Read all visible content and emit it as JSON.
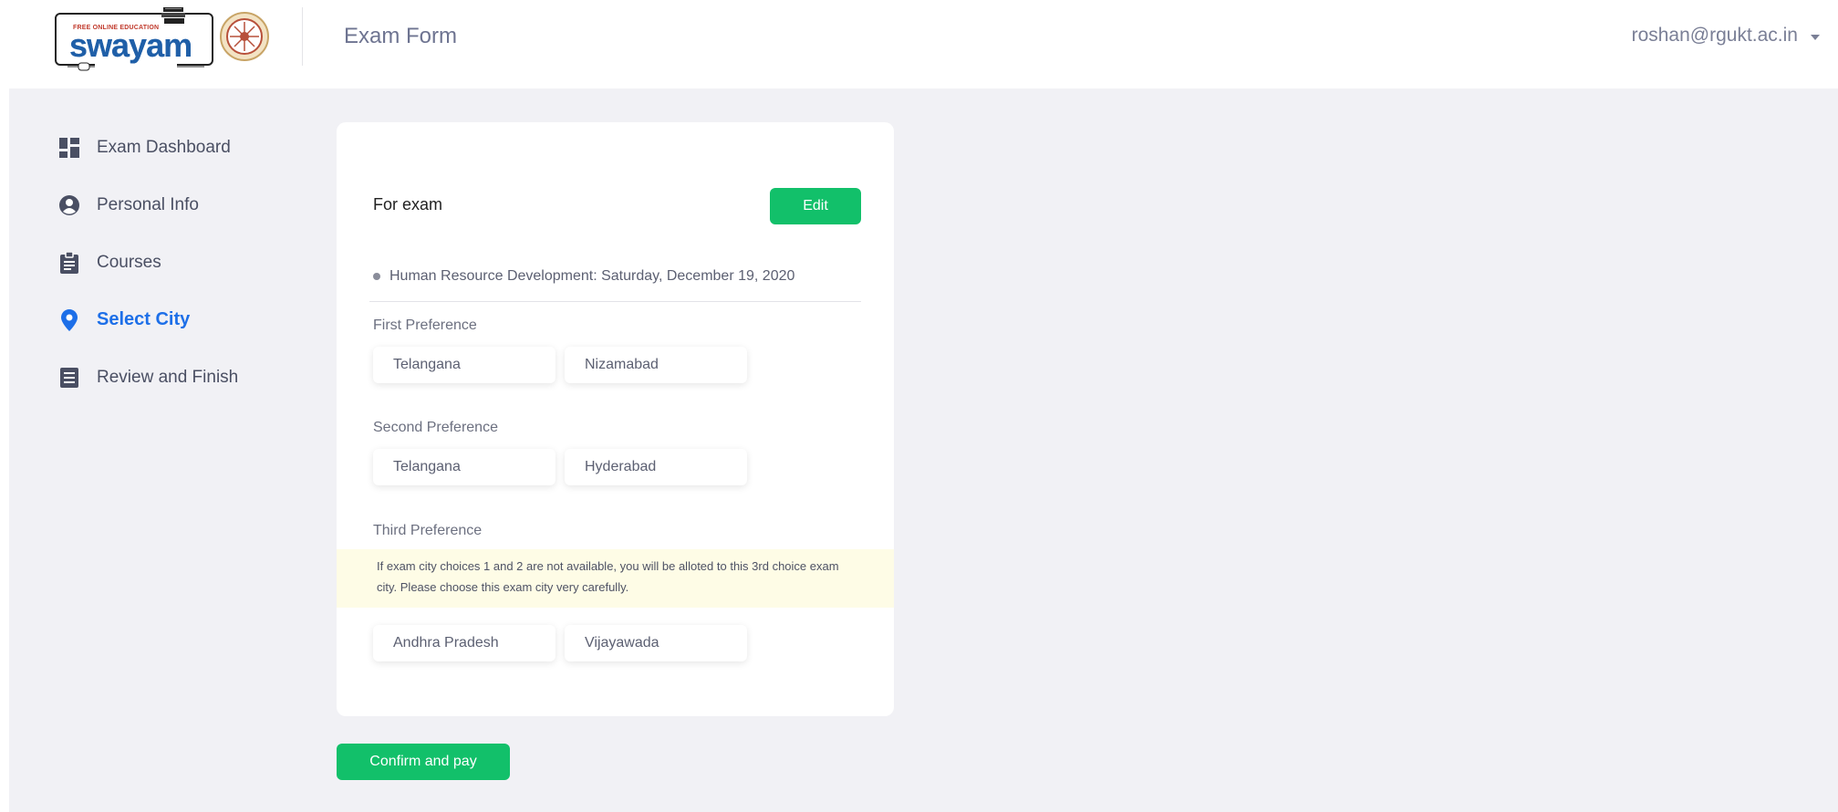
{
  "header": {
    "logo": {
      "tagline": "FREE ONLINE EDUCATION",
      "wordmark": "swayam",
      "subline": "शिक्षित भारत, उन्नत भारत"
    },
    "page_title": "Exam Form",
    "user_email": "roshan@rgukt.ac.in"
  },
  "sidebar": {
    "items": [
      {
        "label": "Exam Dashboard",
        "icon": "dashboard-icon",
        "active": false
      },
      {
        "label": "Personal Info",
        "icon": "user-circle-icon",
        "active": false
      },
      {
        "label": "Courses",
        "icon": "clipboard-icon",
        "active": false
      },
      {
        "label": "Select City",
        "icon": "map-pin-icon",
        "active": true
      },
      {
        "label": "Review and Finish",
        "icon": "document-list-icon",
        "active": false
      }
    ]
  },
  "card": {
    "title": "For exam",
    "edit_label": "Edit",
    "exam_line": "Human Resource Development: Saturday, December 19, 2020",
    "preferences": [
      {
        "label": "First Preference",
        "state": "Telangana",
        "city": "Nizamabad"
      },
      {
        "label": "Second Preference",
        "state": "Telangana",
        "city": "Hyderabad"
      },
      {
        "label": "Third Preference",
        "state": "Andhra Pradesh",
        "city": "Vijayawada"
      }
    ],
    "notice": "If exam city choices 1 and 2 are not available, you will be alloted to this 3rd choice exam city. Please choose this exam city very carefully."
  },
  "actions": {
    "confirm_label": "Confirm and pay"
  },
  "colors": {
    "accent_green": "#12c06a",
    "active_blue": "#1d6fe8",
    "background": "#f1f1f5",
    "notice_bg": "#fefce6"
  }
}
